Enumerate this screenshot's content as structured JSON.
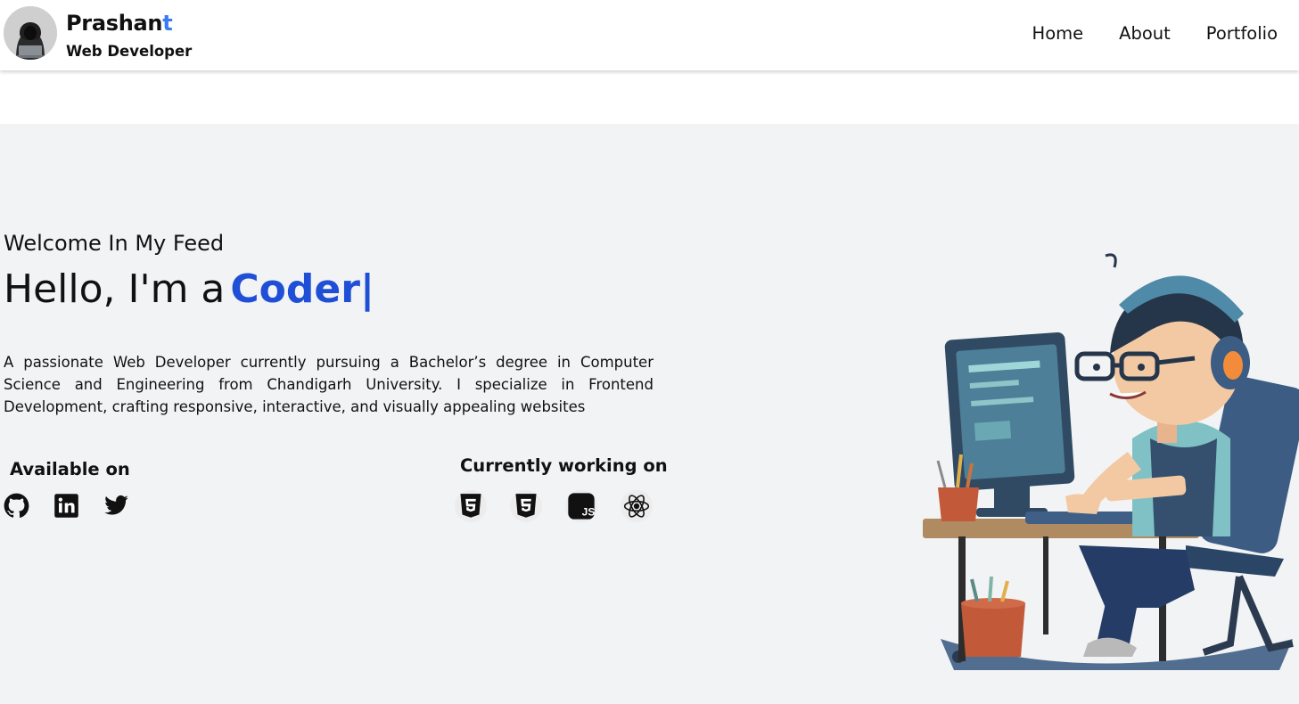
{
  "nav": {
    "brand_name_main": "Prashan",
    "brand_name_accent": "t",
    "brand_role": "Web Developer",
    "links": [
      "Home",
      "About",
      "Portfolio"
    ]
  },
  "hero": {
    "welcome": "Welcome In My Feed",
    "hello_prefix": "Hello, I'm a",
    "typed_role": "Coder",
    "caret": "|",
    "description": "A passionate Web Developer currently pursuing a Bachelor’s degree in Computer Science and Engineering from Chandigarh University. I specialize in Frontend Development, crafting responsive, interactive, and visually appealing websites",
    "available_title": "Available on",
    "social_icons": [
      "github-icon",
      "linkedin-icon",
      "twitter-icon"
    ],
    "working_title": "Currently working on",
    "tech_icons": [
      "html5-icon",
      "css3-icon",
      "javascript-icon",
      "react-icon"
    ]
  },
  "colors": {
    "accent_blue": "#1f4fd6",
    "brand_accent": "#3a7bf0",
    "hero_background": "#f2f3f5"
  }
}
